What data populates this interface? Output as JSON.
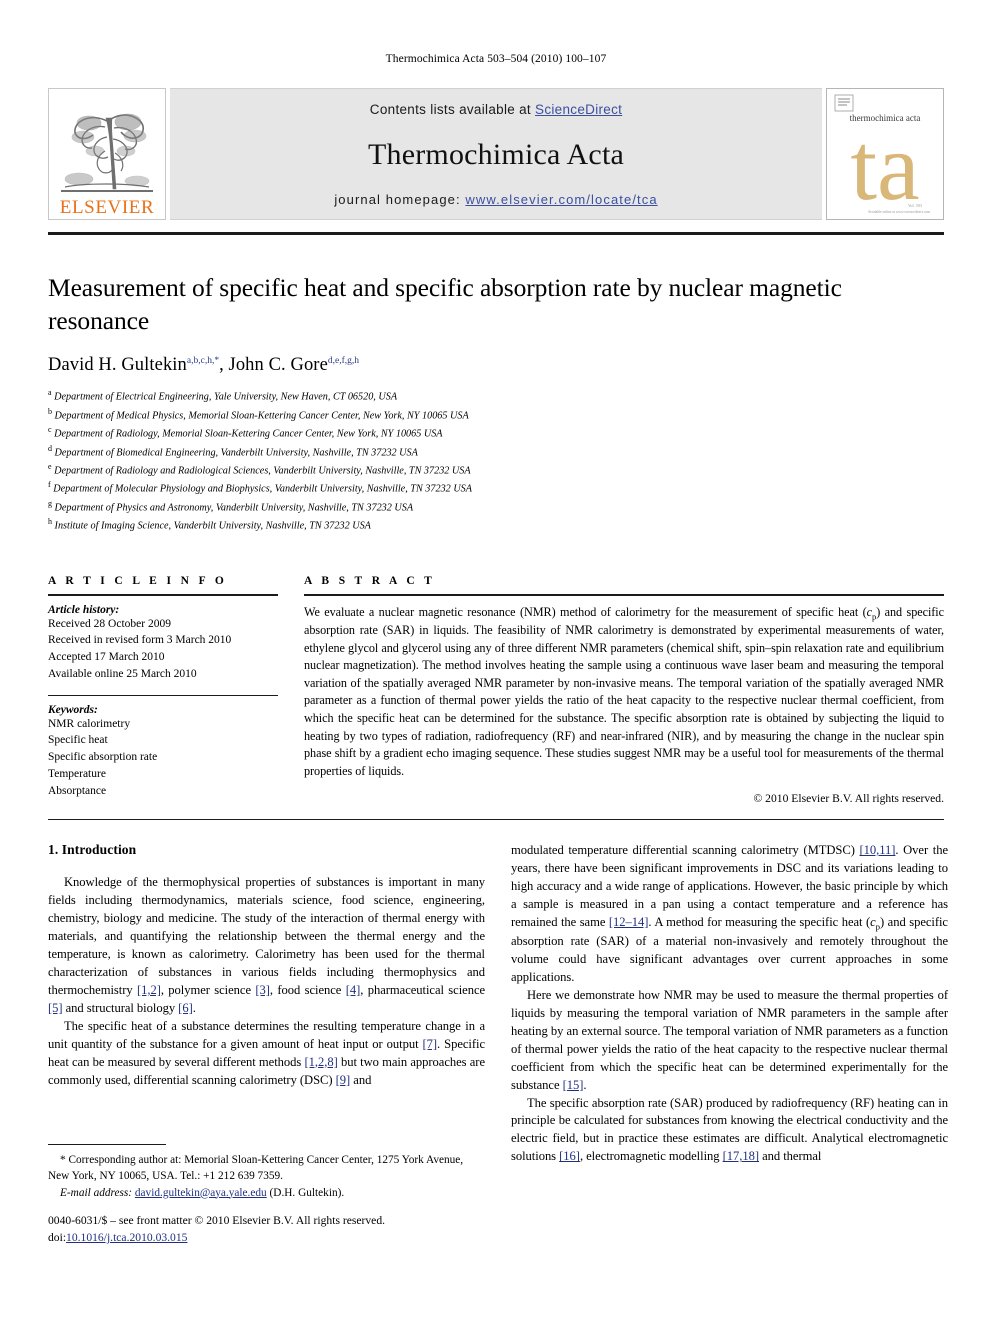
{
  "running_head": "Thermochimica Acta 503–504 (2010) 100–107",
  "masthead": {
    "elsevier_wordmark": "ELSEVIER",
    "contents_prefix": "Contents lists available at ",
    "contents_link": "ScienceDirect",
    "journal_name": "Thermochimica Acta",
    "homepage_prefix": "journal homepage: ",
    "homepage_url": "www.elsevier.com/locate/tca",
    "cover_title": "thermochimica acta",
    "cover_monogram": "ta",
    "cover_accent_color": "#d9b779",
    "link_color": "#3b4fa0",
    "elsevier_orange": "#e8711a"
  },
  "article": {
    "title": "Measurement of specific heat and specific absorption rate by nuclear magnetic resonance",
    "author_1_name": "David H. Gultekin",
    "author_1_sup": "a,b,c,h,*",
    "author_separator": ", ",
    "author_2_name": "John C. Gore",
    "author_2_sup": "d,e,f,g,h",
    "affiliations": [
      {
        "mark": "a",
        "text": "Department of Electrical Engineering, Yale University, New Haven, CT 06520, USA"
      },
      {
        "mark": "b",
        "text": "Department of Medical Physics, Memorial Sloan-Kettering Cancer Center, New York, NY 10065 USA"
      },
      {
        "mark": "c",
        "text": "Department of Radiology, Memorial Sloan-Kettering Cancer Center, New York, NY 10065 USA"
      },
      {
        "mark": "d",
        "text": "Department of Biomedical Engineering, Vanderbilt University, Nashville, TN 37232 USA"
      },
      {
        "mark": "e",
        "text": "Department of Radiology and Radiological Sciences, Vanderbilt University, Nashville, TN 37232 USA"
      },
      {
        "mark": "f",
        "text": "Department of Molecular Physiology and Biophysics, Vanderbilt University, Nashville, TN 37232 USA"
      },
      {
        "mark": "g",
        "text": "Department of Physics and Astronomy, Vanderbilt University, Nashville, TN 37232 USA"
      },
      {
        "mark": "h",
        "text": "Institute of Imaging Science, Vanderbilt University, Nashville, TN 37232 USA"
      }
    ]
  },
  "article_info": {
    "heading": "A R T I C L E    I N F O",
    "history_label": "Article history:",
    "history": [
      "Received 28 October 2009",
      "Received in revised form 3 March 2010",
      "Accepted 17 March 2010",
      "Available online 25 March 2010"
    ],
    "keywords_label": "Keywords:",
    "keywords": [
      "NMR calorimetry",
      "Specific heat",
      "Specific absorption rate",
      "Temperature",
      "Absorptance"
    ]
  },
  "abstract": {
    "heading": "A B S T R A C T",
    "part_1": "We evaluate a nuclear magnetic resonance (NMR) method of calorimetry for the measurement of specific heat (",
    "cp_italic": "c",
    "cp_sub": "p",
    "part_2": ") and specific absorption rate (SAR) in liquids. The feasibility of NMR calorimetry is demonstrated by experimental measurements of water, ethylene glycol and glycerol using any of three different NMR parameters (chemical shift, spin–spin relaxation rate and equilibrium nuclear magnetization). The method involves heating the sample using a continuous wave laser beam and measuring the temporal variation of the spatially averaged NMR parameter by non-invasive means. The temporal variation of the spatially averaged NMR parameter as a function of thermal power yields the ratio of the heat capacity to the respective nuclear thermal coefficient, from which the specific heat can be determined for the substance. The specific absorption rate is obtained by subjecting the liquid to heating by two types of radiation, radiofrequency (RF) and near-infrared (NIR), and by measuring the change in the nuclear spin phase shift by a gradient echo imaging sequence. These studies suggest NMR may be a useful tool for measurements of the thermal properties of liquids.",
    "copyright": "© 2010 Elsevier B.V. All rights reserved."
  },
  "body": {
    "section_heading": "1. Introduction",
    "left_paragraphs": [
      {
        "segments": [
          {
            "t": "Knowledge of the thermophysical properties of substances is important in many fields including thermodynamics, materials science, food science, engineering, chemistry, biology and medicine. The study of the interaction of thermal energy with materials, and quantifying the relationship between the thermal energy and the temperature, is known as calorimetry. Calorimetry has been used for the thermal characterization of substances in various fields including thermophysics and thermochemistry "
          },
          {
            "t": "[1,2]",
            "ref": true
          },
          {
            "t": ", polymer science "
          },
          {
            "t": "[3]",
            "ref": true
          },
          {
            "t": ", food science "
          },
          {
            "t": "[4]",
            "ref": true
          },
          {
            "t": ", pharmaceutical science "
          },
          {
            "t": "[5]",
            "ref": true
          },
          {
            "t": " and structural biology "
          },
          {
            "t": "[6]",
            "ref": true
          },
          {
            "t": "."
          }
        ]
      },
      {
        "segments": [
          {
            "t": "The specific heat of a substance determines the resulting temperature change in a unit quantity of the substance for a given amount of heat input or output "
          },
          {
            "t": "[7]",
            "ref": true
          },
          {
            "t": ". Specific heat can be measured by several different methods "
          },
          {
            "t": "[1,2,8]",
            "ref": true
          },
          {
            "t": " but two main approaches are commonly used, differential scanning calorimetry (DSC) "
          },
          {
            "t": "[9]",
            "ref": true
          },
          {
            "t": " and"
          }
        ]
      }
    ],
    "right_paragraphs": [
      {
        "noindent": true,
        "segments": [
          {
            "t": "modulated temperature differential scanning calorimetry (MTDSC) "
          },
          {
            "t": "[10,11]",
            "ref": true
          },
          {
            "t": ". Over the years, there have been significant improvements in DSC and its variations leading to high accuracy and a wide range of applications. However, the basic principle by which a sample is measured in a pan using a contact temperature and a reference has remained the same "
          },
          {
            "t": "[12–14]",
            "ref": true
          },
          {
            "t": ". A method for measuring the specific heat ("
          },
          {
            "t": "c",
            "italic": true
          },
          {
            "t": "p",
            "sub": true
          },
          {
            "t": ") and specific absorption rate (SAR) of a material non-invasively and remotely throughout the volume could have significant advantages over current approaches in some applications."
          }
        ]
      },
      {
        "segments": [
          {
            "t": "Here we demonstrate how NMR may be used to measure the thermal properties of liquids by measuring the temporal variation of NMR parameters in the sample after heating by an external source. The temporal variation of NMR parameters as a function of thermal power yields the ratio of the heat capacity to the respective nuclear thermal coefficient from which the specific heat can be determined experimentally for the substance "
          },
          {
            "t": "[15]",
            "ref": true
          },
          {
            "t": "."
          }
        ]
      },
      {
        "segments": [
          {
            "t": "The specific absorption rate (SAR) produced by radiofrequency (RF) heating can in principle be calculated for substances from knowing the electrical conductivity and the electric field, but in practice these estimates are difficult. Analytical electromagnetic solutions "
          },
          {
            "t": "[16]",
            "ref": true
          },
          {
            "t": ", electromagnetic modelling "
          },
          {
            "t": "[17,18]",
            "ref": true
          },
          {
            "t": " and thermal"
          }
        ]
      }
    ]
  },
  "footnote": {
    "star": "*",
    "text": " Corresponding author at: Memorial Sloan-Kettering Cancer Center, 1275 York Avenue, New York, NY 10065, USA. Tel.: +1 212 639 7359.",
    "email_label": "E-mail address:",
    "email": "david.gultekin@aya.yale.edu",
    "email_owner": "(D.H. Gultekin)."
  },
  "imprint": {
    "line_1": "0040-6031/$ – see front matter © 2010 Elsevier B.V. All rights reserved.",
    "doi_label": "doi:",
    "doi": "10.1016/j.tca.2010.03.015"
  }
}
